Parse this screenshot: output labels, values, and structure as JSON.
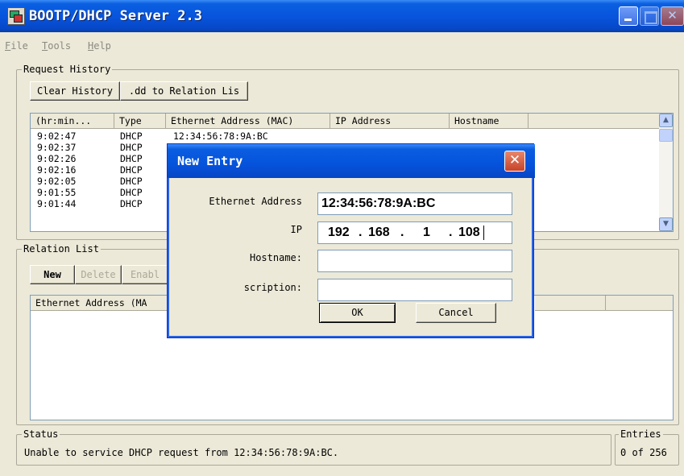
{
  "window": {
    "title": "BOOTP/DHCP Server 2.3"
  },
  "menu": [
    {
      "mnemonic": "F",
      "rest": "ile"
    },
    {
      "mnemonic": "T",
      "rest": "ools"
    },
    {
      "mnemonic": "H",
      "rest": "elp"
    }
  ],
  "request_history": {
    "group_label": "Request History",
    "clear_button": "Clear History",
    "add_button": ".dd to Relation Lis",
    "columns": [
      "(hr:min...",
      "Type",
      "Ethernet Address (MAC)",
      "IP Address",
      "Hostname"
    ],
    "rows": [
      {
        "time": "9:02:47",
        "type": "DHCP",
        "mac": "12:34:56:78:9A:BC"
      },
      {
        "time": "9:02:37",
        "type": "DHCP",
        "mac": ""
      },
      {
        "time": "9:02:26",
        "type": "DHCP",
        "mac": ""
      },
      {
        "time": "9:02:16",
        "type": "DHCP",
        "mac": ""
      },
      {
        "time": "9:02:05",
        "type": "DHCP",
        "mac": ""
      },
      {
        "time": "9:01:55",
        "type": "DHCP",
        "mac": ""
      },
      {
        "time": "9:01:44",
        "type": "DHCP",
        "mac": ""
      }
    ]
  },
  "relation_list": {
    "group_label": "Relation List",
    "new_button": "New",
    "delete_button": "Delete",
    "enable_button": "Enabl",
    "columns": [
      "Ethernet Address (MA"
    ]
  },
  "status": {
    "label": "Status",
    "text": "Unable to service DHCP request from 12:34:56:78:9A:BC.",
    "entries_label": "Entries",
    "entries_value": "0 of 256"
  },
  "dialog": {
    "title": "New Entry",
    "ethernet_label": "Ethernet Address",
    "ethernet_value": "12:34:56:78:9A:BC",
    "ip_label": "IP",
    "ip_octets": [
      "192",
      "168",
      "1",
      "108"
    ],
    "hostname_label": "Hostname:",
    "hostname_value": "",
    "description_label": "scription:",
    "description_value": "",
    "ok_button": "OK",
    "cancel_button": "Cancel"
  },
  "colors": {
    "titlebar": "#0855dd",
    "face": "#ece9d8",
    "close_button": "#c6432a"
  }
}
